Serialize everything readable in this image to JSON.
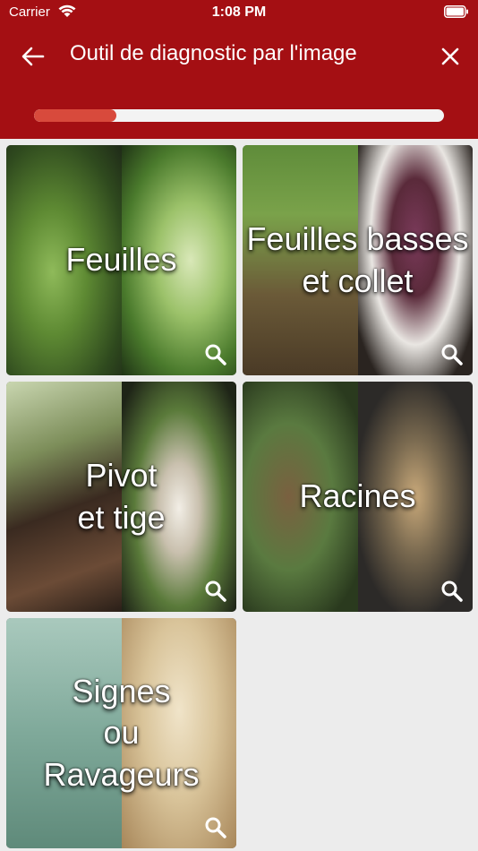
{
  "status_bar": {
    "carrier": "Carrier",
    "time": "1:08 PM"
  },
  "nav": {
    "title": "Outil de diagnostic par l'image",
    "back_icon": "arrow-left-icon",
    "close_icon": "close-icon"
  },
  "progress": {
    "value": 0.2
  },
  "tiles": [
    {
      "label": "Feuilles",
      "icon": "magnifier-icon"
    },
    {
      "label": "Feuilles basses\net collet",
      "icon": "magnifier-icon"
    },
    {
      "label": "Pivot\net tige",
      "icon": "magnifier-icon"
    },
    {
      "label": "Racines",
      "icon": "magnifier-icon"
    },
    {
      "label": "Signes\nou\nRavageurs",
      "icon": "magnifier-icon"
    }
  ],
  "colors": {
    "header": "#a40f13",
    "progress_fill": "#d84a3c",
    "progress_track": "#f3f3f3",
    "background": "#ececec"
  }
}
